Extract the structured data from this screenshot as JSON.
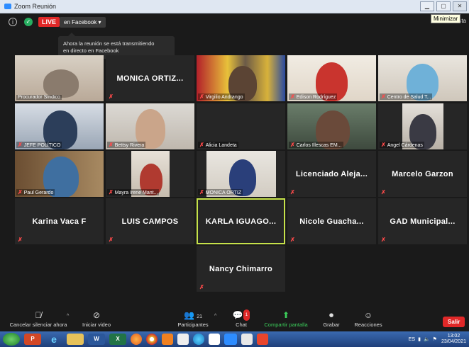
{
  "window": {
    "title": "Zoom Reunión",
    "tooltip": "Minimizar",
    "view_label": "Vista"
  },
  "topbar": {
    "live_label": "LIVE",
    "facebook_label": "en Facebook ▾"
  },
  "banner": {
    "line1": "Ahora la reunión se está transmitiendo",
    "line2": "en directo en Facebook"
  },
  "tiles": [
    {
      "label": "Procurador Síndico"
    },
    {
      "big_name": "MONICA  ORTIZ..."
    },
    {
      "label": "Virgilio Andrango"
    },
    {
      "label": "Edison Rodríguez"
    },
    {
      "label": "Centro de Salud T..."
    },
    {
      "label": "JEFE POLÍTICO"
    },
    {
      "label": "Bettsy Rivera"
    },
    {
      "label": "Alicia Landeta"
    },
    {
      "label": "Carlos Illescas EM..."
    },
    {
      "label": "Angel Cárdenas"
    },
    {
      "label": "Paul Gerardo"
    },
    {
      "label": "Mayra Irene Mant..."
    },
    {
      "label": "MONICA ORTIZ"
    },
    {
      "big_name": "Licenciado  Aleja..."
    },
    {
      "big_name": "Marcelo Garzon"
    },
    {
      "big_name": "Karina Vaca F"
    },
    {
      "big_name": "LUIS CAMPOS"
    },
    {
      "big_name": "KARLA  IGUAGO..."
    },
    {
      "big_name": "Nicole  Guacha..."
    },
    {
      "big_name": "GAD  Municipal..."
    },
    {
      "big_name": "Nancy Chimarro"
    }
  ],
  "controls": {
    "unmute": "Cancelar silenciar ahora",
    "video": "Iniciar video",
    "participants": "Participantes",
    "participants_count": "21",
    "chat": "Chat",
    "chat_badge": "1",
    "share": "Compartir pantalla",
    "record": "Grabar",
    "reactions": "Reacciones",
    "leave": "Salir"
  },
  "taskbar": {
    "items": [
      "P",
      "e",
      "",
      "W",
      "X",
      "",
      "",
      "",
      "",
      "",
      "",
      "",
      "",
      ""
    ],
    "lang": "ES",
    "time": "13:02",
    "date": "23/04/2021"
  },
  "colors": {
    "live": "#e02828",
    "speaking_border": "#c6e24a",
    "share_green": "#3ccf5b",
    "muted_red": "#ff4a4a"
  }
}
